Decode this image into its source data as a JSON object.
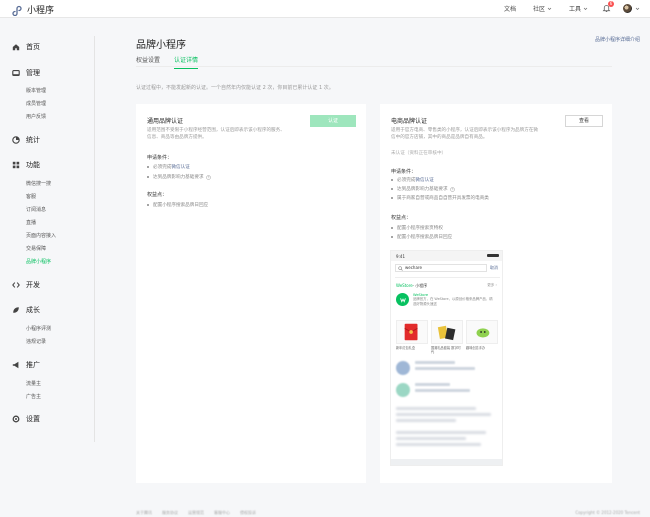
{
  "app": {
    "name": "小程序"
  },
  "topnav": {
    "docs": "文档",
    "community": "社区",
    "tools": "工具",
    "notification_count": "6"
  },
  "sidebar": {
    "groups": [
      {
        "label": "首页",
        "icon": "home-icon"
      },
      {
        "label": "管理",
        "icon": "manage-icon",
        "items": [
          "版本管理",
          "成员管理",
          "用户反馈"
        ]
      },
      {
        "label": "统计",
        "icon": "stats-icon"
      },
      {
        "label": "功能",
        "icon": "function-icon",
        "items": [
          "微信搜一搜",
          "客服",
          "订阅消息",
          "直播",
          "页面内容接入",
          "交易保障",
          "品牌小程序"
        ]
      },
      {
        "label": "开发",
        "icon": "code-icon"
      },
      {
        "label": "成长",
        "icon": "growth-icon",
        "items": [
          "小程序评测",
          "违规记录"
        ]
      },
      {
        "label": "推广",
        "icon": "promote-icon",
        "items": [
          "流量主",
          "广告主"
        ]
      },
      {
        "label": "设置",
        "icon": "settings-icon"
      }
    ],
    "active_item": "品牌小程序"
  },
  "page": {
    "title": "品牌小程序",
    "detail_link": "品牌小程序详细介绍",
    "tabs": [
      {
        "label": "权益设置",
        "active": false
      },
      {
        "label": "认证详情",
        "active": true
      }
    ],
    "notice": "认证过程中，不能发起新的认证。一个自然年内仅能认证 2 次，你目前已累计认证 1 次。"
  },
  "card_general": {
    "title": "通用品牌认证",
    "desc": "适用范围不受限于小程序经营范围，认证后即表示该小程序的服务、信息、商品等由品牌方提供。",
    "button": "认证",
    "conditions_title": "申请条件：",
    "conditions": [
      {
        "prefix": "· ",
        "text": "必须完成",
        "link": "微信认证",
        "help": false
      },
      {
        "prefix": "· ",
        "text": "达到品牌影响力基础要求",
        "link": "",
        "help": true
      }
    ],
    "benefits_title": "权益点：",
    "benefits": [
      "配置小程序搜索品牌日回应"
    ]
  },
  "card_ecom": {
    "title": "电商品牌认证",
    "desc": "适用于官方电商、零售类的小程序，认证后即表示该小程序为品牌方在微信中的官方店铺，其中的商品是品牌自有商品。",
    "button": "查看",
    "status": "未认证（资料正在审核中）",
    "conditions_title": "申请条件：",
    "conditions": [
      {
        "text": "必须完成",
        "link": "微信认证",
        "help": false
      },
      {
        "text": "达到品牌影响力基础要求",
        "link": "",
        "help": true
      },
      {
        "text": "属于商家自营或商品自自营开具发票的电商类",
        "link": "",
        "help": false
      }
    ],
    "benefits_title": "权益点：",
    "benefits": [
      "配置小程序搜索页特权",
      "配置小程序搜索品牌日回应"
    ]
  },
  "phone_preview": {
    "time": "9:41",
    "search_query": "wechare",
    "cancel": "取消",
    "section_brand": "WeStore",
    "section_label": "· 小程序",
    "more": "更多 ›",
    "brand_name": "WeStore",
    "brand_desc": "品牌官方，在 WeStore，以原创价格来品牌产品，精选好物源头速送",
    "products": [
      {
        "caption": "新年红包礼盒",
        "icon": "red-envelope-icon"
      },
      {
        "caption": "国潮礼品套装 数字时代",
        "icon": "gift-set-icon"
      },
      {
        "caption": "趣味创意手办",
        "icon": "toy-icon"
      }
    ]
  },
  "footer": {
    "links": [
      "关于腾讯",
      "服务协议",
      "运营规范",
      "客服中心",
      "侵权投诉"
    ],
    "copyright": "Copyright © 2012-2020 Tencent"
  }
}
